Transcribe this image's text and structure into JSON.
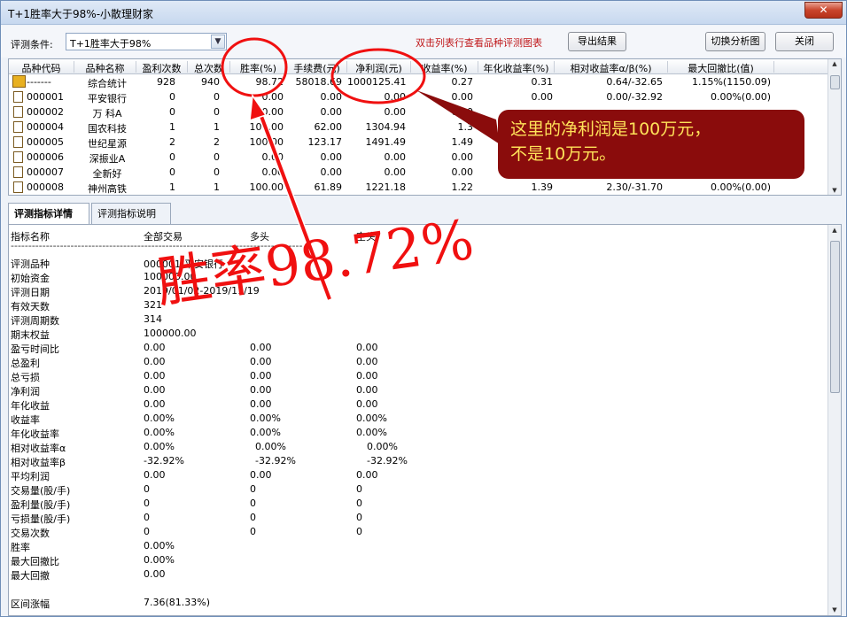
{
  "window": {
    "title": "T+1胜率大于98%-小散理财家",
    "close": "✕"
  },
  "toolbar": {
    "condition_label": "评测条件:",
    "condition_value": "T+1胜率大于98%",
    "hint": "双击列表行查看品种评测图表",
    "export_label": "导出结果",
    "switch_label": "切换分析图",
    "close_label": "关闭"
  },
  "grid": {
    "headers": [
      "品种代码",
      "品种名称",
      "盈利次数",
      "总次数",
      "胜率(%)",
      "手续费(元)",
      "净利润(元)",
      "收益率(%)",
      "年化收益率(%)",
      "相对收益率α/β(%)",
      "最大回撤比(值)"
    ],
    "rows": [
      [
        "-------",
        "综合统计",
        "928",
        "940",
        "98.72",
        "58018.69",
        "1000125.41",
        "0.27",
        "0.31",
        "0.64/-32.65",
        "1.15%(1150.09)"
      ],
      [
        "000001",
        "平安银行",
        "0",
        "0",
        "0.00",
        "0.00",
        "0.00",
        "0.00",
        "0.00",
        "0.00/-32.92",
        "0.00%(0.00)"
      ],
      [
        "000002",
        "万 科A",
        "0",
        "0",
        "0.00",
        "0.00",
        "0.00",
        "0.00",
        "",
        "",
        ""
      ],
      [
        "000004",
        "国农科技",
        "1",
        "1",
        "100.00",
        "62.00",
        "1304.94",
        "1.3",
        "",
        "",
        ""
      ],
      [
        "000005",
        "世纪星源",
        "2",
        "2",
        "100.00",
        "123.17",
        "1491.49",
        "1.49",
        "",
        "",
        ""
      ],
      [
        "000006",
        "深振业A",
        "0",
        "0",
        "0.00",
        "0.00",
        "0.00",
        "0.00",
        "",
        "",
        ""
      ],
      [
        "000007",
        "全新好",
        "0",
        "0",
        "0.00",
        "0.00",
        "0.00",
        "0.00",
        "",
        "",
        ""
      ],
      [
        "000008",
        "神州高铁",
        "1",
        "1",
        "100.00",
        "61.89",
        "1221.18",
        "1.22",
        "1.39",
        "2.30/-31.70",
        "0.00%(0.00)"
      ]
    ]
  },
  "tabs": {
    "detail": "评测指标详情",
    "explain": "评测指标说明"
  },
  "detail": {
    "col_headers": [
      "指标名称",
      "全部交易",
      "多头",
      "空头"
    ],
    "separator": "-----------------------------------------------------------------------------------",
    "rows": [
      [
        "评测品种",
        "000001-平安银行",
        "",
        ""
      ],
      [
        "初始资金",
        "100000.00",
        "",
        ""
      ],
      [
        "评测日期",
        "2019/01/02-2019/11/19",
        "",
        ""
      ],
      [
        "有效天数",
        "321",
        "",
        ""
      ],
      [
        "评测周期数",
        "314",
        "",
        ""
      ],
      [
        "期末权益",
        "100000.00",
        "",
        ""
      ],
      [
        "盈亏时间比",
        "0.00",
        "0.00",
        "0.00"
      ],
      [
        "总盈利",
        "0.00",
        "0.00",
        "0.00"
      ],
      [
        "总亏损",
        "0.00",
        "0.00",
        "0.00"
      ],
      [
        "净利润",
        "0.00",
        "0.00",
        "0.00"
      ],
      [
        "年化收益",
        "0.00",
        "0.00",
        "0.00"
      ],
      [
        "收益率",
        "0.00%",
        "0.00%",
        "0.00%"
      ],
      [
        "年化收益率",
        "0.00%",
        "0.00%",
        "0.00%"
      ],
      [
        "相对收益率α",
        "0.00%",
        "0.00%",
        "0.00%"
      ],
      [
        "相对收益率β",
        "-32.92%",
        "-32.92%",
        "-32.92%"
      ],
      [
        "平均利润",
        "0.00",
        "0.00",
        "0.00"
      ],
      [
        "交易量(股/手)",
        "0",
        "0",
        "0"
      ],
      [
        "盈利量(股/手)",
        "0",
        "0",
        "0"
      ],
      [
        "亏损量(股/手)",
        "0",
        "0",
        "0"
      ],
      [
        "交易次数",
        "0",
        "0",
        "0"
      ],
      [
        "胜率",
        "0.00%",
        "",
        ""
      ],
      [
        "最大回撤比",
        "0.00%",
        "",
        ""
      ],
      [
        "最大回撤",
        "0.00",
        "",
        ""
      ],
      [
        "",
        "",
        "",
        ""
      ],
      [
        "区间涨幅",
        "7.36(81.33%)",
        "",
        ""
      ]
    ]
  },
  "annotations": {
    "callout_line1": "这里的净利润是100万元，",
    "callout_line2": "不是10万元。",
    "big_text": "胜率98.72%",
    "color": "#f01010"
  }
}
